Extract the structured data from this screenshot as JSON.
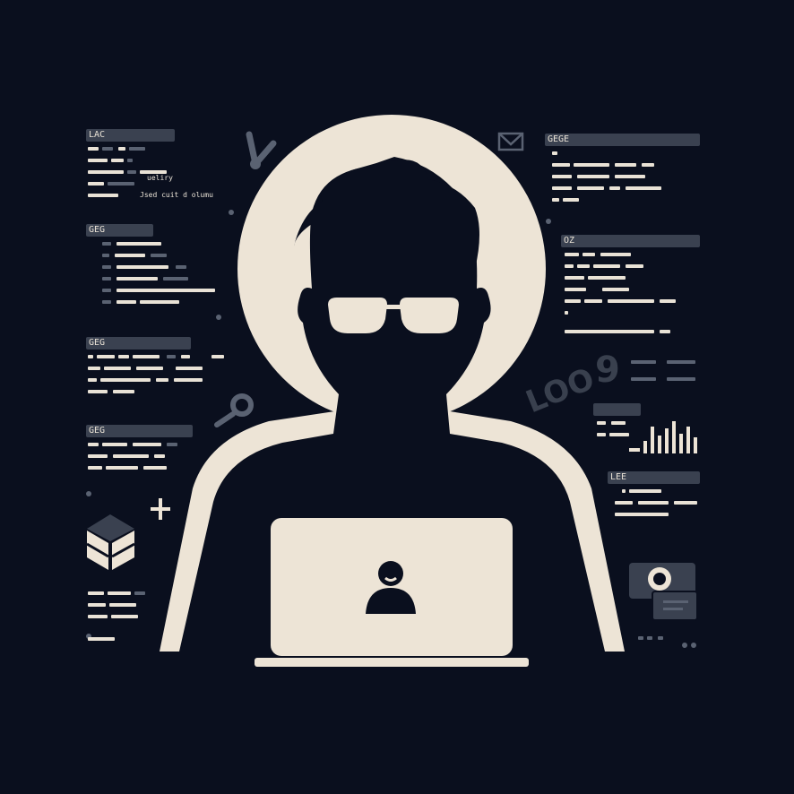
{
  "panels": {
    "left_1": {
      "header": "LAC"
    },
    "left_2": {
      "header": "GEG"
    },
    "left_3": {
      "header": "GEG"
    },
    "left_4": {
      "header": "GEG"
    },
    "right_1": {
      "header": "GEGE"
    },
    "right_2": {
      "header": "OZ"
    },
    "right_5": {
      "header": "LEE"
    }
  },
  "snippets": {
    "left_1_text": "Jsed cuit d olumu",
    "left_1_small": "ueliry"
  },
  "decor": {
    "loo": "LOO",
    "nine": "9"
  },
  "icons": [
    "mail-icon",
    "wrench-icon",
    "magnifier-icon",
    "plus-icon",
    "cube-icon",
    "camera-icon",
    "person-silhouette-icon",
    "user-logo-icon"
  ],
  "colors": {
    "background": "#0a0f1e",
    "cream": "#ede4d6",
    "panel": "#3a4150"
  }
}
